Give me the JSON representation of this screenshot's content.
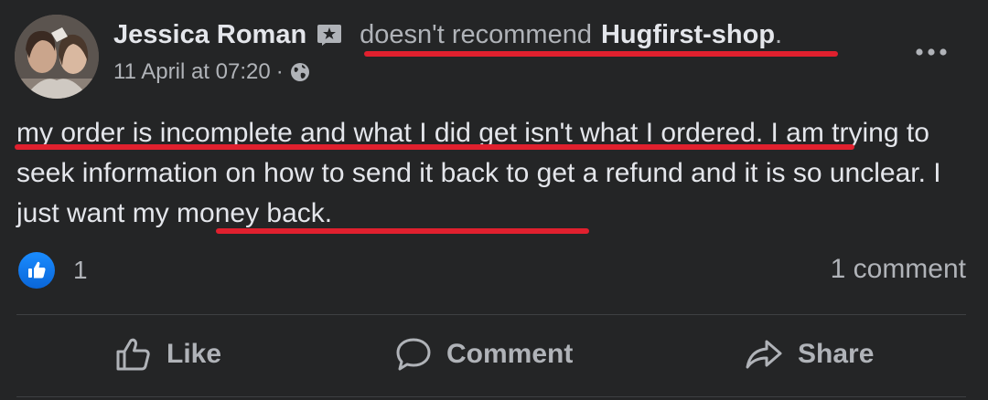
{
  "post": {
    "author_name": "Jessica Roman",
    "action_text": "doesn't recommend",
    "page_name": "Hugfirst-shop",
    "period": ".",
    "timestamp": "11 April at 07:20",
    "meta_separator": "·",
    "privacy_icon": "globe-icon",
    "body_parts": [
      "my order is incomplete and what I did get isn't what I ordered",
      ". I am trying to seek information on how to send it back to get a refund and it is so unclear. ",
      "I just want my money back."
    ]
  },
  "stats": {
    "reaction_icon": "like-icon",
    "like_count": "1",
    "comment_count": "1 comment"
  },
  "actions": {
    "like_label": "Like",
    "comment_label": "Comment",
    "share_label": "Share"
  },
  "colors": {
    "background": "#242526",
    "text_primary": "#e4e6eb",
    "text_secondary": "#b0b3b8",
    "like_blue": "#1877f2",
    "annotation_red": "#e0202e"
  }
}
